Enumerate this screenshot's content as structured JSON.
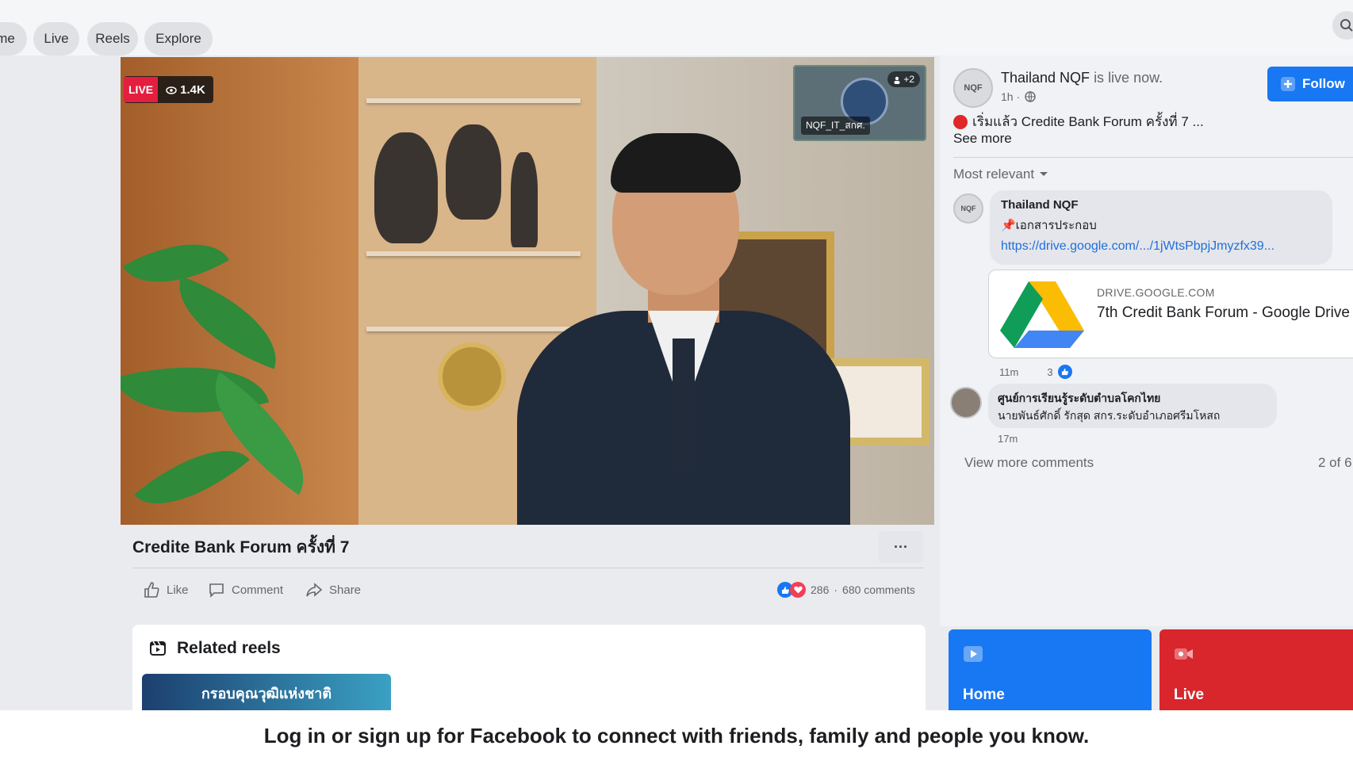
{
  "nav": {
    "tabs": [
      {
        "label": "me"
      },
      {
        "label": "Live"
      },
      {
        "label": "Reels"
      },
      {
        "label": "Explore"
      }
    ]
  },
  "video": {
    "live_label": "LIVE",
    "viewer_count": "1.4K",
    "pip_participants": "+2",
    "pip_name": "NQF_IT_สกศ.",
    "title": "Credite Bank Forum ครั้งที่ 7",
    "more_label": "···"
  },
  "actions": {
    "like": "Like",
    "comment": "Comment",
    "share": "Share",
    "reaction_count": "286",
    "comment_count": "680 comments"
  },
  "post": {
    "author": "Thailand NQF",
    "status": "is live now.",
    "time": "1h ·",
    "follow_label": "Follow",
    "text": "เริ่มแล้ว Credite Bank Forum ครั้งที่ 7 ...",
    "see_more": "See more",
    "avatar_text": "NQF"
  },
  "comments": {
    "sort_label": "Most relevant",
    "items": [
      {
        "author": "Thailand NQF",
        "text": "📌เอกสารประกอบ",
        "link": "https://drive.google.com/.../1jWtsPbpjJmyzfx39...",
        "preview_domain": "DRIVE.GOOGLE.COM",
        "preview_title": "7th Credit Bank Forum - Google Drive",
        "time": "11m",
        "likes": "3"
      },
      {
        "author": "ศูนย์การเรียนรู้ระดับตำบลโคกไทย",
        "text": "นายพันธ์ศักดิ์ รักสุด สกร.ระดับอำเภอศรีมโหสถ",
        "time": "17m"
      }
    ],
    "view_more": "View more comments",
    "page_count": "2 of 6"
  },
  "related": {
    "title": "Related reels",
    "reel_text": "กรอบคุณวุฒิแห่งชาติ"
  },
  "tiles": [
    {
      "label": "Home",
      "color": "#1877f2"
    },
    {
      "label": "Live",
      "color": "#d9252c"
    }
  ],
  "login_bar": {
    "text": "Log in or sign up for Facebook to connect with friends, family and people you know."
  },
  "colors": {
    "accent": "#1877f2",
    "live_red": "#e41e3f",
    "love_red": "#f33e58"
  }
}
